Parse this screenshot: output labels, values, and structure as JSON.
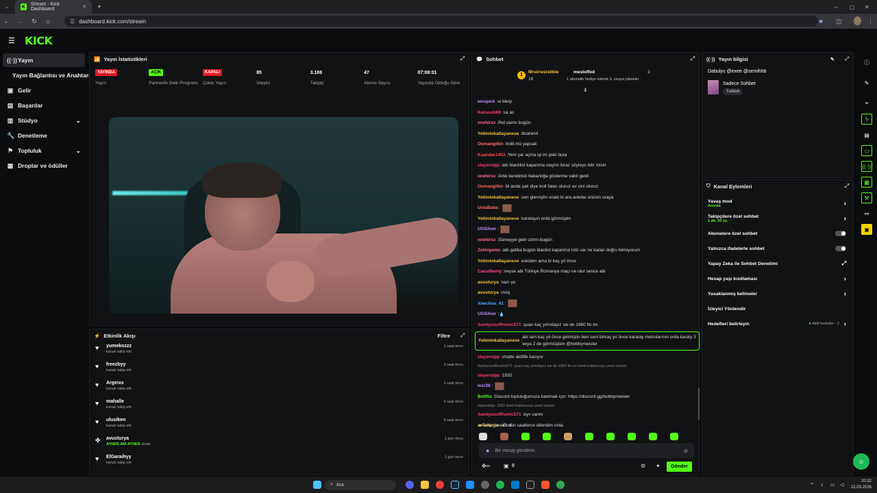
{
  "browser": {
    "tab_title": "Stream - Kick Dashboard",
    "url": "dashboard.kick.com/stream"
  },
  "app": {
    "logo": "KICK"
  },
  "sidebar": {
    "items": [
      {
        "label": "Yayın",
        "icon": "broadcast-icon",
        "active": true
      },
      {
        "label": "Yayın Bağlantısı ve Anahtarı",
        "icon": "",
        "active": false
      },
      {
        "label": "Gelir",
        "icon": "dollar-icon",
        "active": false
      },
      {
        "label": "Başarılar",
        "icon": "trophy-icon",
        "active": false
      },
      {
        "label": "Stüdyo",
        "icon": "studio-icon",
        "active": false,
        "expandable": true
      },
      {
        "label": "Denetleme",
        "icon": "wrench-icon",
        "active": false
      },
      {
        "label": "Topluluk",
        "icon": "community-icon",
        "active": false,
        "expandable": true
      },
      {
        "label": "Droplar ve ödüller",
        "icon": "gift-icon",
        "active": false
      }
    ]
  },
  "stats_panel": {
    "title": "Yayın İstatistikleri",
    "stats": [
      {
        "value": "YAYINDA",
        "label": "Yayın",
        "badge": "red"
      },
      {
        "value": "AÇIK",
        "label": "Partnerlik Gelir Programı",
        "badge": "green"
      },
      {
        "value": "KAPALI",
        "label": "Çoklu Yayın",
        "badge": "red"
      },
      {
        "value": "85",
        "label": "İzleyici",
        "badge": ""
      },
      {
        "value": "3.169",
        "label": "Takipçi",
        "badge": ""
      },
      {
        "value": "47",
        "label": "Abone Sayısı",
        "badge": ""
      },
      {
        "value": "07:08:01",
        "label": "Yayında Olduğu Süre",
        "badge": ""
      }
    ]
  },
  "activity": {
    "title": "Etkinlik Akışı",
    "filter": "Filtre",
    "items": [
      {
        "name": "yumekozzz",
        "sub": "kanalı takip etti",
        "time": "1 saat önce",
        "icon": "heart-icon",
        "extra": ""
      },
      {
        "name": "freezbyy",
        "sub": "kanalı takip etti",
        "time": "3 saat önce",
        "icon": "heart-icon",
        "extra": ""
      },
      {
        "name": "Argeixx",
        "sub": "kanalı takip etti",
        "time": "3 saat önce",
        "icon": "heart-icon",
        "extra": ""
      },
      {
        "name": "mahalle",
        "sub": "kanalı takip etti",
        "time": "5 saat önce",
        "icon": "heart-icon",
        "extra": ""
      },
      {
        "name": "ulusiken",
        "sub": "kanalı takip etti",
        "time": "6 saat önce",
        "icon": "heart-icon",
        "extra": ""
      },
      {
        "name": "avusturya",
        "sub": "alındı",
        "time": "1 gün önce",
        "icon": "reward-icon",
        "extra": "AYNEN ABİ AYNEN"
      },
      {
        "name": "ElGaraihyy",
        "sub": "kanalı takip etti",
        "time": "1 gün önce",
        "icon": "heart-icon",
        "extra": ""
      }
    ]
  },
  "chat": {
    "title": "Sohbet",
    "pinned": {
      "user1": "Mrsirresistible",
      "user1_count": "16",
      "user2": "mestoffxd",
      "count": "3",
      "note": "1 abonelik hediye ederek 3. sıraya yükselin"
    },
    "messages": [
      {
        "user": "woxpick",
        "color": "#c48cff",
        "text": "w blerp",
        "emote": false
      },
      {
        "user": "Kansuzk69",
        "color": "#ff3d6e",
        "text": "sa as",
        "emote": false
      },
      {
        "user": "xnehirxz",
        "color": "#ff6b8b",
        "text": "Rol varmı bugün",
        "emote": false
      },
      {
        "user": "Yetimtokatlayanexe",
        "color": "#f5c542",
        "text": "ibrahimli",
        "emote": false
      },
      {
        "user": "Osmangitkn",
        "color": "#ff6b6b",
        "text": "trolli mü yapsak",
        "emote": false
      },
      {
        "user": "Kaandar1453",
        "color": "#ff4d4d",
        "text": "Yeni çar açma işi mi peki bura",
        "emote": false
      },
      {
        "user": "slayerslpp",
        "color": "#ff3d6e",
        "text": "abi blacklist kapanma olayını biraz söyleye bilir misin",
        "emote": false
      },
      {
        "user": "xnehirxz",
        "color": "#ff6b8b",
        "text": "Artık kendimizi bakanlığa gösterme vakti geldi",
        "emote": false
      },
      {
        "user": "Osmangitkn",
        "color": "#ff6b6b",
        "text": "bi anda şak diye troll falan oluruz ev cini oluruz",
        "emote": false
      },
      {
        "user": "Yetimtokatlayanexe",
        "color": "#f5c542",
        "text": "sen glemiştin snaki bi ara antebe ününin oraya",
        "emote": false
      },
      {
        "user": "UstaBaba",
        "color": "#ff6b6b",
        "text": "",
        "emote": true
      },
      {
        "user": "Yetimtokatlayanexe",
        "color": "#f5c542",
        "text": "karatayın orda görmüştm",
        "emote": false
      },
      {
        "user": "UGSilver",
        "color": "#c48cff",
        "text": "",
        "emote": true
      },
      {
        "user": "xnehirxz",
        "color": "#ff6b8b",
        "text": "Sümeyye gelir ozmn bugün",
        "emote": false
      },
      {
        "user": "Zehirgamo",
        "color": "#ff6b8b",
        "text": "abi galiba bugün blaclist kapanma rolü var ne kadar doğru bilmiyorum",
        "emote": false
      },
      {
        "user": "Yetimtokatlayanexe",
        "color": "#f5c542",
        "text": "eskiden ama bi kaç yıl önce",
        "emote": false
      },
      {
        "user": "Cassilberty",
        "color": "#ff4d8d",
        "text": "neyse abi Türkiye Romanya maçı ne olur sence abi",
        "emote": false
      },
      {
        "user": "avusturya",
        "color": "#f5c542",
        "text": "nazı yo",
        "emote": false
      },
      {
        "user": "avusturya",
        "color": "#f5c542",
        "text": "müq",
        "emote": false
      },
      {
        "user": "Xnechos_41",
        "color": "#5aa9ff",
        "text": "",
        "emote": true
      },
      {
        "user": "UGSilver",
        "color": "#c48cff",
        "text": "💧",
        "emote": false
      },
      {
        "user": "SamiyusufRumic571",
        "color": "#ff3d6e",
        "text": "şuan kaç yılındayız sw de 1960 fin mı",
        "emote": false
      }
    ],
    "highlight": {
      "user": "Yetimtokatlayanexe",
      "text": "abi sen kaç yıl önce gelmiştin ben seni birkaç yıl önce karatay metrolarının orda karaty 3 veya 2 de görmüştüm @bobbymeister"
    },
    "after": [
      {
        "type": "msg",
        "user": "slayerslpp",
        "color": "#ff3d6e",
        "text": "chatte aktiflik kasıyor"
      },
      {
        "type": "reply",
        "text": "SamiyusufRumic571: şuan kaç yılındayız sw de 1960 fin mı isimli kullanıcıya yanıt veriyor"
      },
      {
        "type": "msg",
        "user": "slayerslpp",
        "color": "#ff3d6e",
        "text": "1932"
      },
      {
        "type": "msg",
        "user": "lesr28",
        "color": "#c48cff",
        "text": "",
        "emote": true
      },
      {
        "type": "msg",
        "user": "BotRix",
        "color": "#53fc18",
        "text": "Discord topluluğumuza katılmak için: https://discord.gg/bobbymeister"
      },
      {
        "type": "reply",
        "text": "slayerslpp: 1932 isimli kullanıcıya yanıt veriyor"
      },
      {
        "type": "msg",
        "user": "SamiyusufRumic571",
        "color": "#ff3d6e",
        "text": "eyv canm"
      },
      {
        "type": "msg",
        "user": "avusturya",
        "color": "#f5c542",
        "text": "abi dün saatlerce dilendim orda"
      }
    ],
    "followers_only": "Takipçilere Özel",
    "input_placeholder": "Bir mesaj gönderin",
    "points": "0",
    "send": "Gönder"
  },
  "stream_info": {
    "title": "Yayın bilgisi",
    "stream_title": "Dabulyu @exee @semihhb",
    "category": "Sadece Sohbet",
    "tag": "Turkish"
  },
  "channel_actions": {
    "title": "Kanal Eylemleri",
    "items": [
      {
        "label": "Yavaş mod",
        "sub": "Anında",
        "control": "arrow"
      },
      {
        "label": "Takipçilere özel sohbet",
        "sub": "1 dk. 30 sn.",
        "control": "arrow"
      },
      {
        "label": "Abonelere özel sohbet",
        "sub": "",
        "control": "toggle"
      },
      {
        "label": "Yalnızca ifadelerle sohbet",
        "sub": "",
        "control": "toggle"
      },
      {
        "label": "Yapay Zeka ile Sohbet Denetimi",
        "sub": "",
        "control": "external"
      },
      {
        "label": "Hesap yaşı kısıtlaması",
        "sub": "",
        "control": "arrow"
      },
      {
        "label": "Yasaklanmış kelimeler",
        "sub": "",
        "control": "arrow"
      },
      {
        "label": "İzleyici Yönlendir",
        "sub": "",
        "control": "none"
      },
      {
        "label": "Hedefleri belirleyin",
        "sub": "",
        "control": "arrow",
        "note": "Aktif hedefler - 2"
      }
    ]
  },
  "taskbar": {
    "search": "Ara",
    "time": "20:32",
    "date": "22.03.2026"
  }
}
